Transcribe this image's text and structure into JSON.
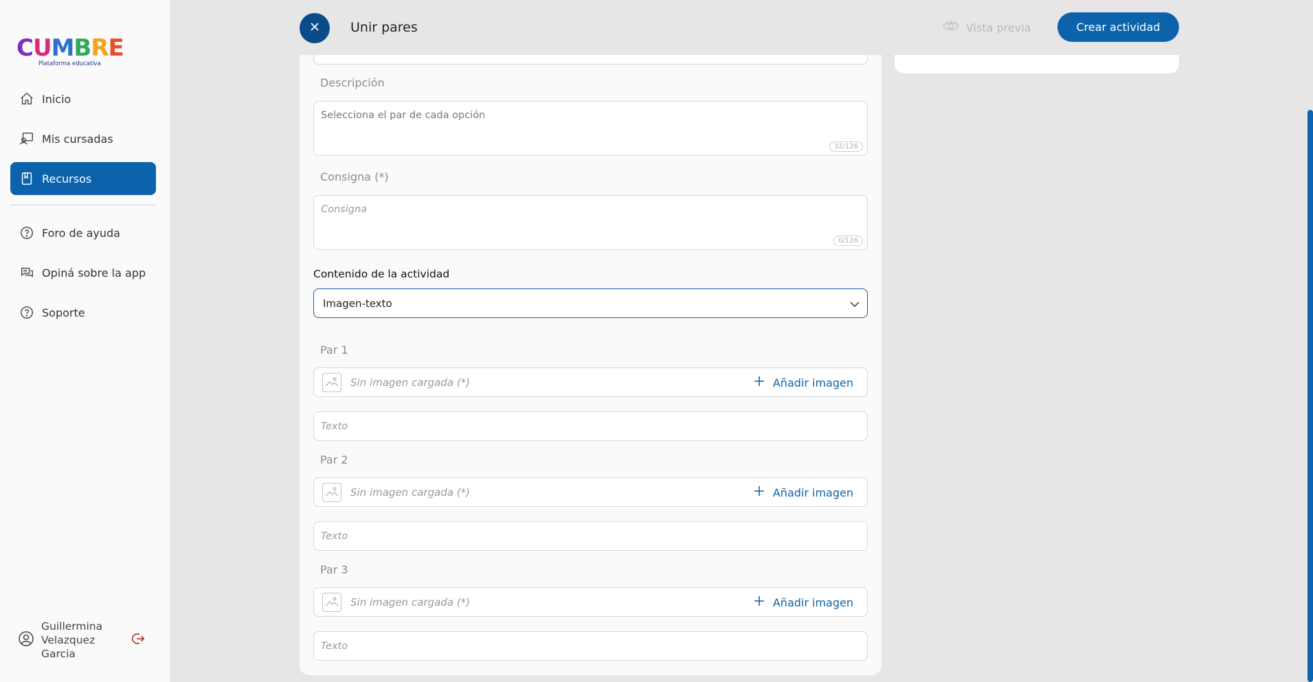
{
  "logo": {
    "letters": [
      {
        "char": "C",
        "color": "#7b2fbe"
      },
      {
        "char": "U",
        "color": "#d62c7c"
      },
      {
        "char": "M",
        "color": "#2d6fd1"
      },
      {
        "char": "B",
        "color": "#2eaa5a"
      },
      {
        "char": "R",
        "color": "#f2a31b"
      },
      {
        "char": "E",
        "color": "#e2532d"
      }
    ],
    "subtitle": "Plataforma educativa"
  },
  "sidebar": {
    "items": [
      {
        "label": "Inicio",
        "icon": "home-icon"
      },
      {
        "label": "Mis cursadas",
        "icon": "courses-icon"
      },
      {
        "label": "Recursos",
        "icon": "book-icon",
        "active": true
      },
      {
        "label": "Foro de ayuda",
        "icon": "help-icon"
      },
      {
        "label": "Opiná sobre la app",
        "icon": "chat-icon"
      },
      {
        "label": "Soporte",
        "icon": "help-icon"
      }
    ],
    "user": {
      "name": "Guillermina Velazquez Garcia",
      "icon": "user-icon",
      "logout_icon": "logout-icon"
    }
  },
  "header": {
    "title": "Unir pares",
    "preview_label": "Vista previa",
    "create_label": "Crear actividad"
  },
  "form": {
    "description_label": "Descripción",
    "description_value": "Selecciona el par de cada opción",
    "description_counter": "32/126",
    "instruction_label": "Consigna (*)",
    "instruction_placeholder": "Consigna",
    "instruction_counter": "0/126",
    "content_label": "Contenido de la actividad",
    "content_selected": "Imagen-texto",
    "pairs": [
      {
        "label": "Par 1",
        "image_placeholder": "Sin imagen cargada (*)",
        "add_image": "Añadir imagen",
        "text_placeholder": "Texto"
      },
      {
        "label": "Par 2",
        "image_placeholder": "Sin imagen cargada (*)",
        "add_image": "Añadir imagen",
        "text_placeholder": "Texto"
      },
      {
        "label": "Par 3",
        "image_placeholder": "Sin imagen cargada (*)",
        "add_image": "Añadir imagen",
        "text_placeholder": "Texto"
      }
    ]
  },
  "colors": {
    "primary": "#0c63ac",
    "close_button": "#0a4c8a",
    "logout": "#b3261e",
    "background": "#e6e6e6"
  }
}
